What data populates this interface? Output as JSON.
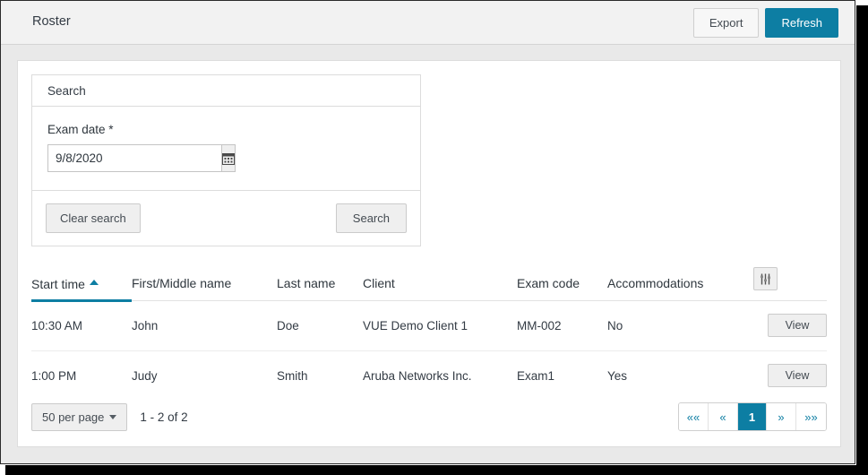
{
  "header": {
    "title": "Roster",
    "export_label": "Export",
    "refresh_label": "Refresh",
    "accent_color": "#0d7ea3"
  },
  "search_panel": {
    "title": "Search",
    "exam_date_label": "Exam date *",
    "exam_date_value": "9/8/2020",
    "exam_date_placeholder": "",
    "calendar_icon": "calendar-icon",
    "clear_label": "Clear search",
    "search_label": "Search"
  },
  "table": {
    "columns": [
      {
        "label": "Start time",
        "sorted": true,
        "sort_direction": "asc"
      },
      {
        "label": "First/Middle name",
        "sorted": false
      },
      {
        "label": "Last name",
        "sorted": false
      },
      {
        "label": "Client",
        "sorted": false
      },
      {
        "label": "Exam code",
        "sorted": false
      },
      {
        "label": "Accommodations",
        "sorted": false
      }
    ],
    "settings_icon": "sliders-icon",
    "rows": [
      {
        "start_time": "10:30 AM",
        "first_middle_name": "John",
        "last_name": "Doe",
        "client": "VUE Demo Client 1",
        "exam_code": "MM-002",
        "accommodations": "No",
        "action_label": "View"
      },
      {
        "start_time": "1:00 PM",
        "first_middle_name": "Judy",
        "last_name": "Smith",
        "client": "Aruba Networks Inc.",
        "exam_code": "Exam1",
        "accommodations": "Yes",
        "action_label": "View"
      }
    ]
  },
  "pagination": {
    "per_page_label": "50 per page",
    "record_range": "1 - 2 of 2",
    "first_label": "««",
    "prev_label": "«",
    "current_page": "1",
    "next_label": "»",
    "last_label": "»»"
  }
}
